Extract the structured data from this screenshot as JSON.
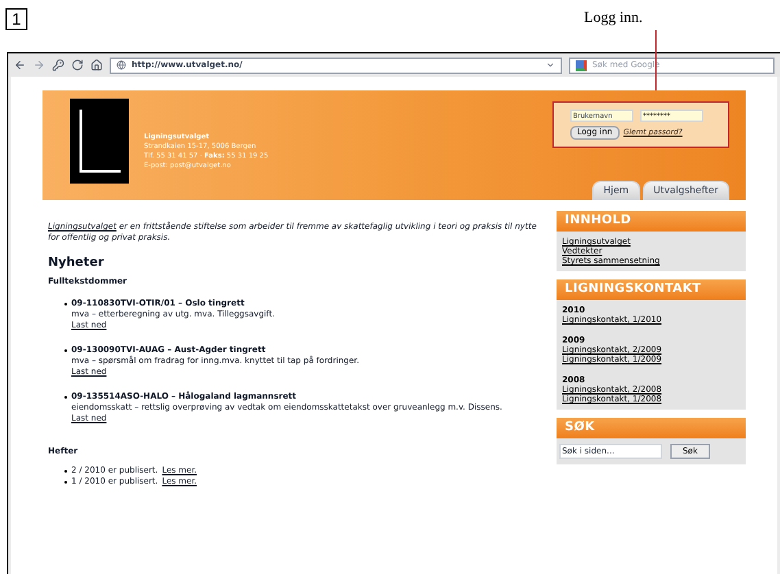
{
  "figure_label": "1",
  "callout": {
    "text": "Logg inn."
  },
  "browser": {
    "url": "http://www.utvalget.no/",
    "search_placeholder": "Søk med Google"
  },
  "header": {
    "org_name": "Ligningsutvalget",
    "address": "Strandkaien 15-17, 5006 Bergen",
    "phone": "Tlf. 55 31 41 57 · **Faks:** 55 31 19 25",
    "email": "E-post: post@utvalget.no"
  },
  "login": {
    "username_placeholder": "Brukernavn",
    "password_value": "********",
    "button": "Logg inn",
    "forgot_link": "Glemt passord?"
  },
  "tabs": [
    {
      "label": "Hjem",
      "selected": false
    },
    {
      "label": "Utvalgshefter",
      "selected": false
    }
  ],
  "intro": {
    "link": "Ligningsutvalget",
    "text": "er en frittstående stiftelse som arbeider til fremme av skattefaglig utvikling i teori og praksis til nytte for offentlig og privat praksis."
  },
  "news": {
    "title": "Nyheter",
    "subtitle": "Fulltekstdommer",
    "items": [
      {
        "title": "09-110830TVI-OTIR/01 – Oslo tingrett",
        "description": "mva – etterberegning av utg. mva. Tilleggsavgift.",
        "link": "Last ned"
      },
      {
        "title": "09-130090TVI-AUAG – Aust-Agder tingrett",
        "description": "mva – spørsmål om fradrag for inng.mva. knyttet til tap på fordringer.",
        "link": "Last ned"
      },
      {
        "title": "09-135514ASO-HALO – Hålogaland lagmannsrett",
        "description": "eiendomsskatt – rettslig overprøving av vedtak om eiendomsskattetakst over gruveanlegg m.v. Dissens.",
        "link": "Last ned"
      }
    ]
  },
  "booklets": {
    "title": "Hefter",
    "items": [
      {
        "text": "2 / 2010 er publisert.",
        "link": "Les mer."
      },
      {
        "text": "1 / 2010 er publisert.",
        "link": "Les mer."
      }
    ]
  },
  "sidebar": {
    "contents": {
      "title": "INNHOLD",
      "links": [
        "Ligningsutvalget",
        "Vedtekter",
        "Styrets sammensetning"
      ]
    },
    "contact": {
      "title": "LIGNINGSKONTAKT",
      "groups": [
        {
          "year": "2010",
          "links": [
            "Ligningskontakt, 1/2010"
          ]
        },
        {
          "year": "2009",
          "links": [
            "Ligningskontakt, 2/2009",
            "Ligningskontakt, 1/2009"
          ]
        },
        {
          "year": "2008",
          "links": [
            "Ligningskontakt, 2/2008",
            "Ligningskontakt, 1/2008"
          ]
        }
      ]
    },
    "search": {
      "title": "SØK",
      "placeholder": "Søk i siden...",
      "button": "Søk"
    }
  }
}
